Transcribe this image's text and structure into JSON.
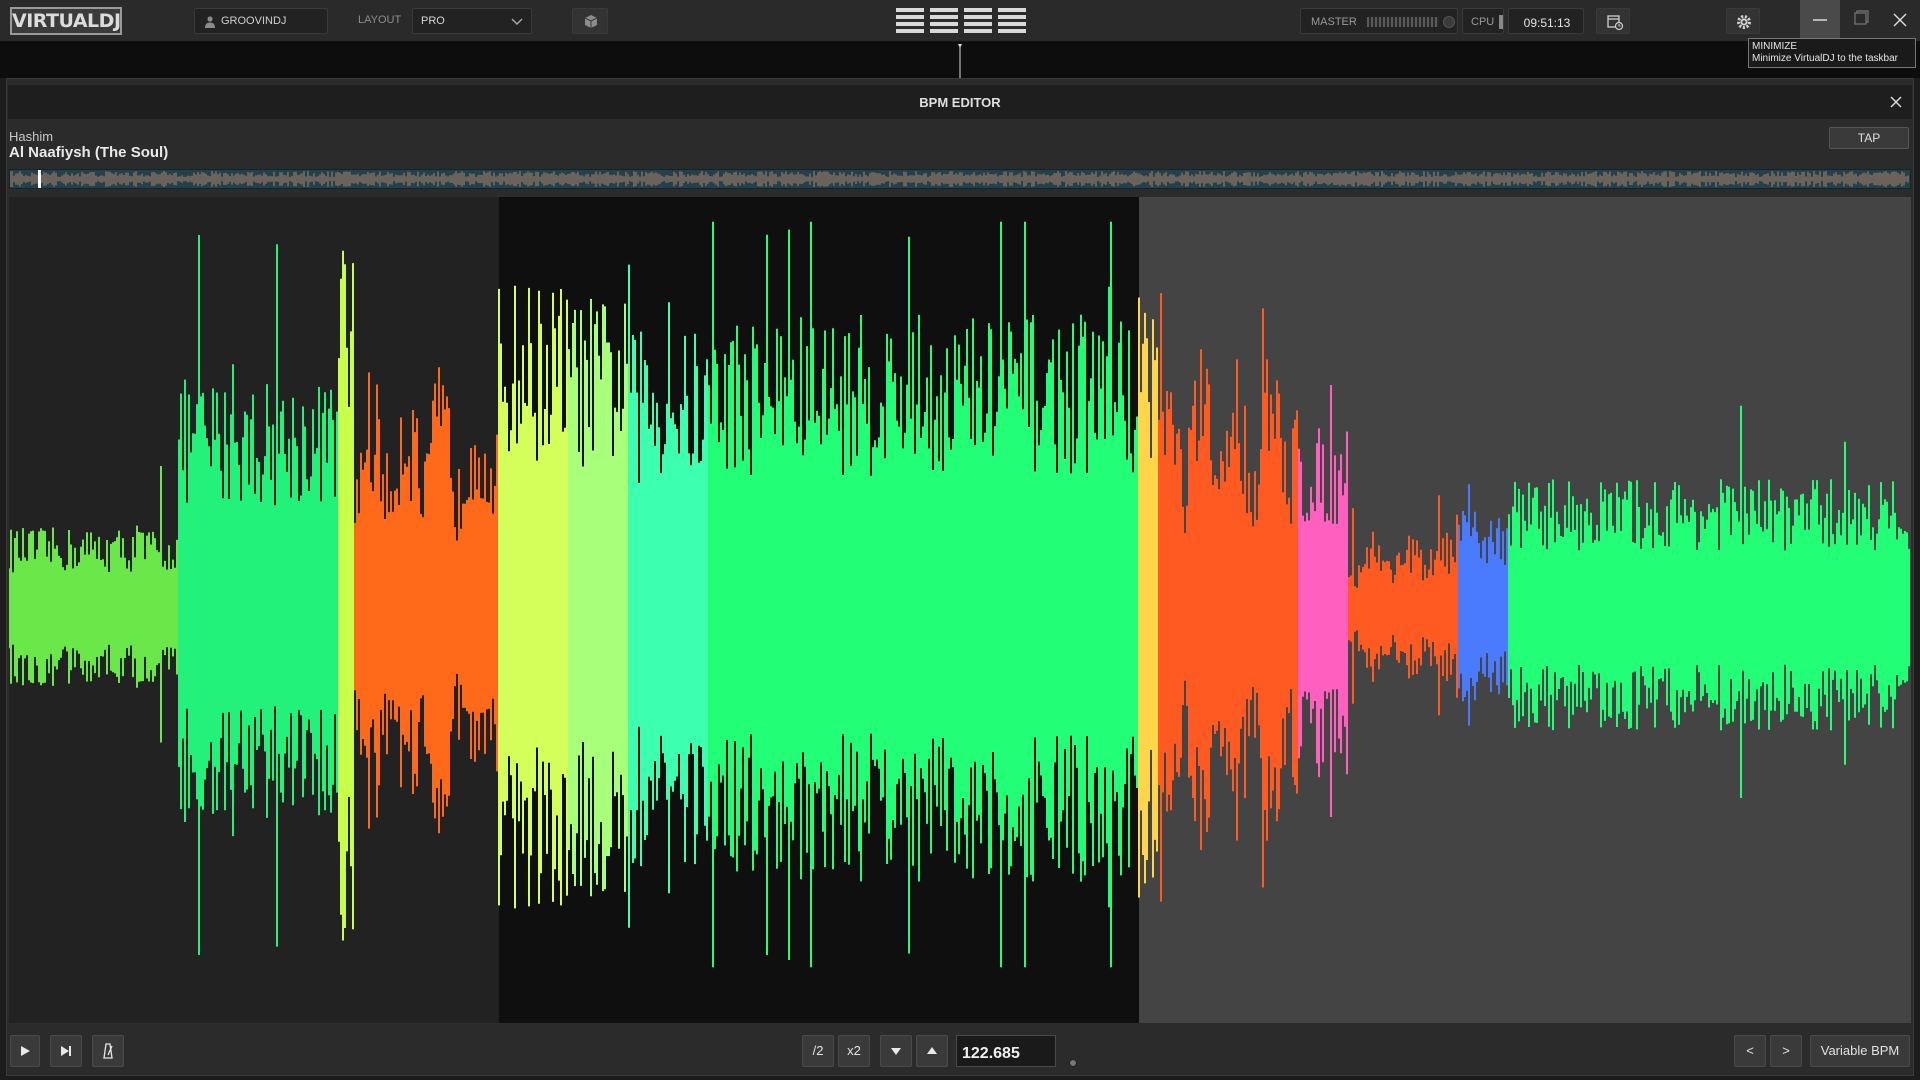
{
  "topbar": {
    "logo": "VIRTUALDJ",
    "user": "GROOVINDJ",
    "layout_label": "LAYOUT",
    "layout_value": "PRO",
    "master_label": "MASTER",
    "cpu_label": "CPU",
    "clock": "09:51:13"
  },
  "tooltip": {
    "title": "MINIMIZE",
    "text": "Minimize VirtualDJ to the taskbar"
  },
  "editor": {
    "title": "BPM EDITOR",
    "artist": "Hashim",
    "song": "Al Naafiysh (The Soul)",
    "tap_label": "TAP"
  },
  "controls": {
    "half_label": "/2",
    "double_label": "x2",
    "bpm_value": "122.685",
    "prev_label": "<",
    "next_label": ">",
    "variable_bpm_label": "Variable BPM"
  },
  "icons": {
    "user": "user-icon",
    "layout_dropdown": "chevron-down-icon",
    "cube": "cube-icon",
    "schedule": "calendar-clock-icon",
    "settings": "gear-icon",
    "minimize": "minimize-icon",
    "maximize": "maximize-icon",
    "close": "close-icon",
    "play": "play-icon",
    "skip": "skip-next-icon",
    "metronome": "metronome-icon",
    "down": "triangle-down-icon",
    "up": "triangle-up-icon"
  },
  "colors": {
    "accent_green": "#22ff77",
    "wave_orange": "#ff6a1a",
    "wave_pink": "#ff5fbf",
    "wave_blue": "#4a7bff"
  }
}
